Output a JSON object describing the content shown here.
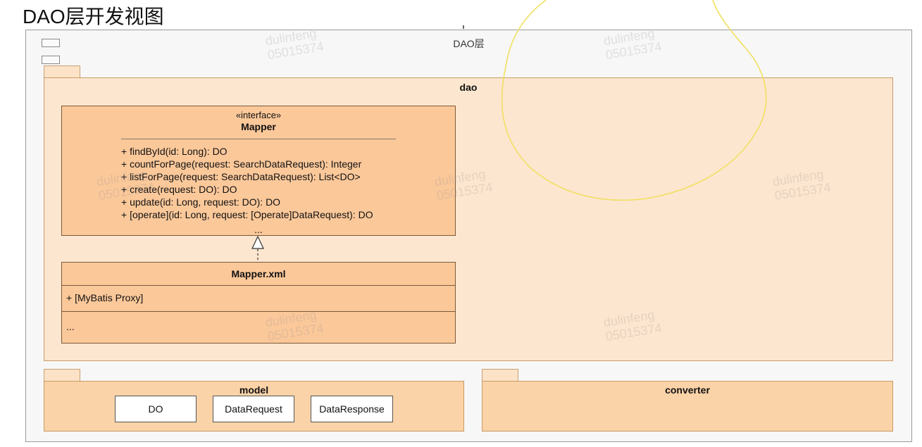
{
  "title": "DAO层开发视图",
  "component": {
    "title": "DAO层"
  },
  "packages": {
    "dao": {
      "name": "dao"
    },
    "model": {
      "name": "model"
    },
    "converter": {
      "name": "converter"
    }
  },
  "mapper": {
    "stereotype": "«interface»",
    "name": "Mapper",
    "methods": [
      "+ findById(id: Long): DO",
      "+ countForPage(request: SearchDataRequest): Integer",
      "+ listForPage(request: SearchDataRequest): List<DO>",
      "+ create(request: DO): DO",
      "+ update(id: Long, request: DO): DO",
      "+ [operate](id: Long, request: [Operate]DataRequest): DO"
    ],
    "ellipsis": "..."
  },
  "mapper_xml": {
    "name": "Mapper.xml",
    "attribute": "+ [MyBatis Proxy]",
    "ellipsis": "..."
  },
  "model_classes": [
    "DO",
    "DataRequest",
    "DataResponse"
  ],
  "watermark": {
    "line1": "dulinfeng",
    "line2": "05015374"
  },
  "colors": {
    "package_fill": "#fbd3a8",
    "dao_fill": "#fde6cf",
    "class_fill": "#fbc89a",
    "annotation_stroke": "#f0e060"
  }
}
